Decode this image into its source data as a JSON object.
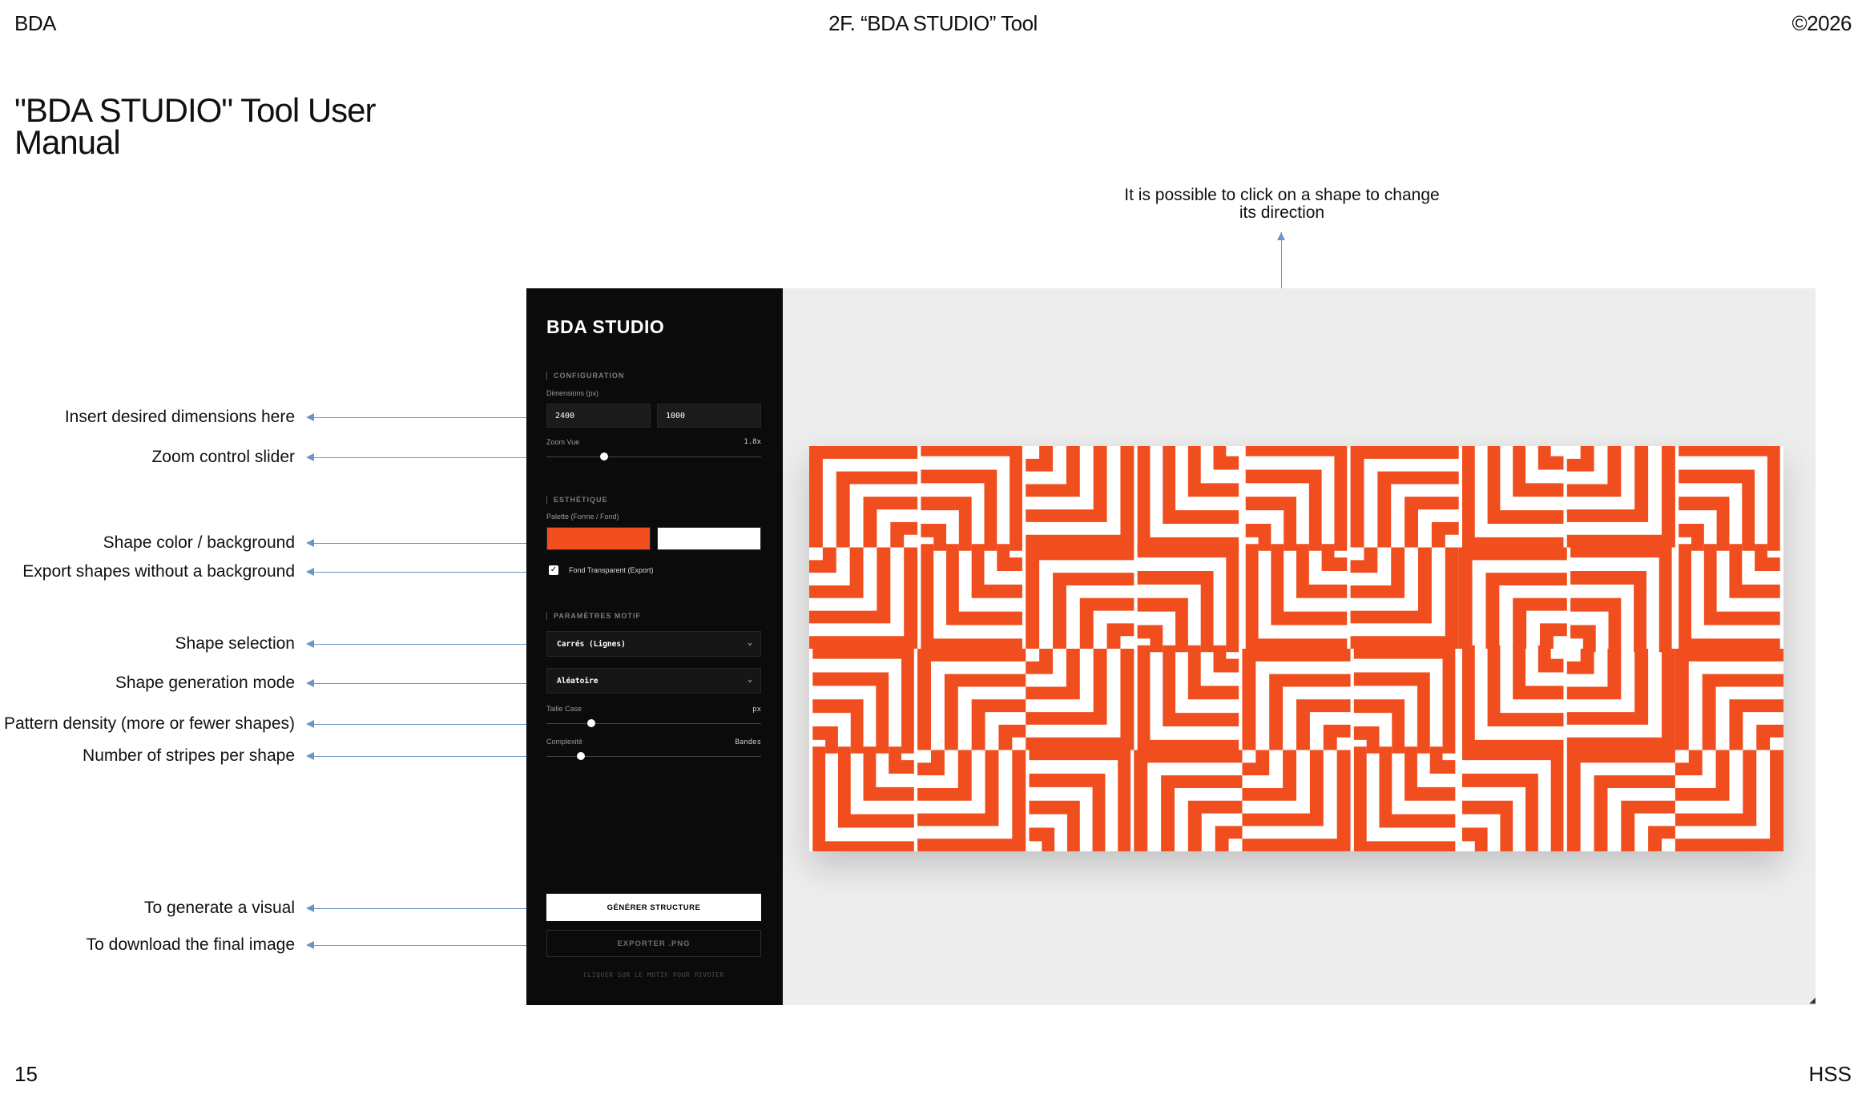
{
  "header": {
    "left": "BDA",
    "center": "2F. “BDA STUDIO” Tool",
    "right": "©2026"
  },
  "footer": {
    "page": "15",
    "right": "HSS"
  },
  "doc_title": "\"BDA STUDIO\" Tool User Manual",
  "top_annotation": "It is possible to click on a shape to change its direction",
  "callouts": {
    "dimensions": "Insert desired dimensions here",
    "zoom": "Zoom control slider",
    "color": "Shape color / background",
    "export_transparent": "Export shapes without a  background",
    "shape_selection": "Shape selection",
    "generation_mode": "Shape generation mode",
    "density": "Pattern density (more or fewer shapes)",
    "stripes": "Number of stripes per shape",
    "generate": "To generate a visual",
    "download": "To download the final image"
  },
  "app": {
    "title": "BDA STUDIO",
    "sections": {
      "configuration": "CONFIGURATION",
      "esthetique": "ESTHÉTIQUE",
      "parametres": "PARAMÈTRES MOTIF"
    },
    "dimensions": {
      "label": "Dimensions (px)",
      "width": "2400",
      "height": "1000"
    },
    "zoom": {
      "label": "Zoom Vue",
      "value": "1.8x",
      "level": 0.27
    },
    "palette": {
      "label": "Palette (Forme / Fond)",
      "shape_color": "#F04E1E",
      "background_color": "#FFFFFF"
    },
    "transparent": {
      "label": "Fond Transparent (Export)",
      "checked": true
    },
    "shape_select": {
      "value": "Carrés (Lignes)"
    },
    "mode_select": {
      "value": "Aléatoire"
    },
    "taille": {
      "label": "Taille Case",
      "unit": "px",
      "level": 0.21
    },
    "complexite": {
      "label": "Complexité",
      "unit": "Bandes",
      "level": 0.16
    },
    "generate_button": "GÉNÉRER STRUCTURE",
    "export_button": "EXPORTER .PNG",
    "hint": "CLIQUER SUR LE MOTIF POUR PIVOTER"
  },
  "colors": {
    "accent": "#F04E1E",
    "leader_line": "#6A95C9",
    "sidebar_bg": "#0B0B0B",
    "canvas_bg": "#EDEDED"
  },
  "pattern": {
    "shape": "nested-square-corners",
    "columns": 9,
    "rows": 4,
    "stripes": 4
  }
}
